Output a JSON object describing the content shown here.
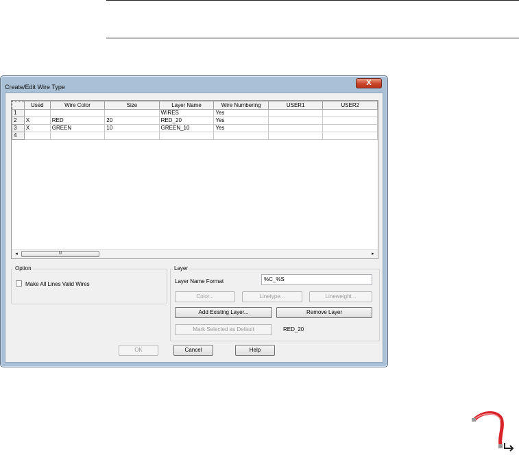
{
  "dialog": {
    "title": "Create/Edit Wire Type",
    "close_label": "X"
  },
  "grid": {
    "columns": [
      "Used",
      "Wire Color",
      "Size",
      "Layer Name",
      "Wire Numbering",
      "USER1",
      "USER2"
    ],
    "rows": [
      {
        "num": "1",
        "cells": [
          "",
          "",
          "",
          "WIRES",
          "Yes",
          "",
          ""
        ]
      },
      {
        "num": "2",
        "cells": [
          "X",
          "RED",
          "20",
          "RED_20",
          "Yes",
          "",
          ""
        ]
      },
      {
        "num": "3",
        "cells": [
          "X",
          "GREEN",
          "10",
          "GREEN_10",
          "Yes",
          "",
          ""
        ]
      },
      {
        "num": "4",
        "cells": [
          "",
          "",
          "",
          "",
          "",
          "",
          ""
        ]
      }
    ],
    "scroll_left": "◂",
    "scroll_right": "▸",
    "thumb_grip": "III"
  },
  "option": {
    "title": "Option",
    "make_all_lines": "Make All Lines Valid Wires",
    "checked": false
  },
  "layer": {
    "title": "Layer",
    "format_label": "Layer Name Format",
    "format_value": "%C_%S",
    "color_btn": "Color...",
    "linetype_btn": "Linetype...",
    "lineweight_btn": "Lineweight...",
    "add_btn": "Add Existing Layer...",
    "remove_btn": "Remove Layer",
    "mark_btn": "Mark Selected as Default",
    "default_value": "RED_20"
  },
  "buttons": {
    "ok": "OK",
    "cancel": "Cancel",
    "help": "Help"
  },
  "colors": {
    "titlebar": "#a9c0d6",
    "close": "#c9452a",
    "wire_icon": "#d8232a"
  },
  "icons": {
    "wire": "wire-type-icon",
    "close": "close-icon"
  }
}
